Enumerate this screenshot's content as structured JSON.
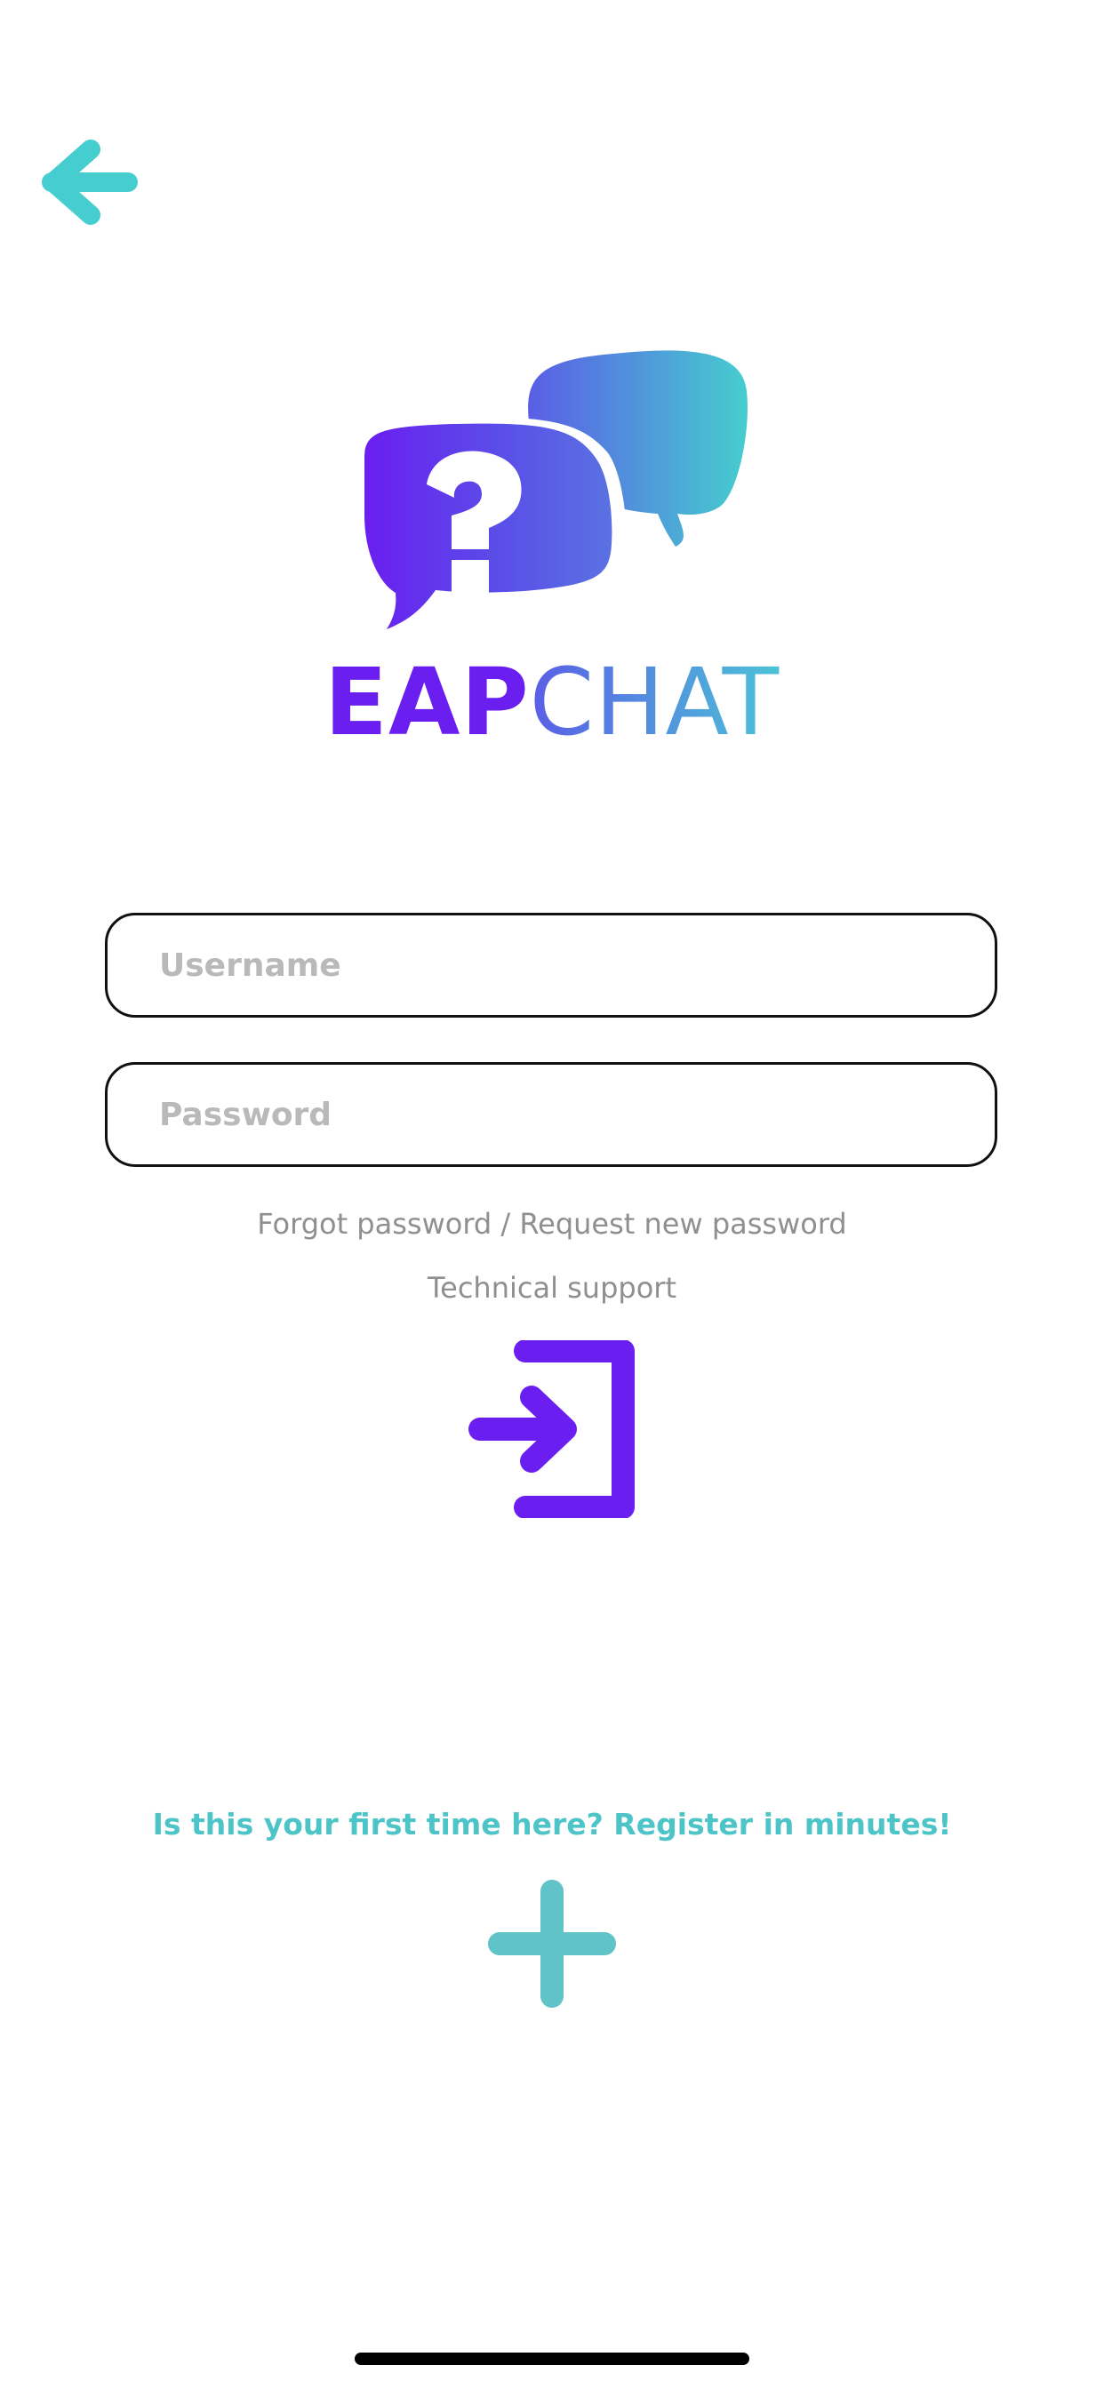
{
  "header": {
    "back_icon": "arrow-left-icon",
    "back_color": "#46cdcf"
  },
  "brand": {
    "logo_icon": "speech-bubbles-question-icon",
    "name_bold": "EAP",
    "name_light": "CHAT",
    "color_primary": "#6a1ef0",
    "color_secondary": "#46cdcf"
  },
  "login_form": {
    "username_placeholder": "Username",
    "username_value": "",
    "password_placeholder": "Password",
    "password_value": "",
    "forgot_password_link": "Forgot password / Request new password",
    "support_link": "Technical support",
    "login_icon": "sign-in-icon",
    "login_color": "#6a1ef0"
  },
  "register": {
    "prompt_text": "Is this your first time here? Register in minutes!",
    "register_icon": "plus-icon",
    "color": "#5fc3c8"
  }
}
